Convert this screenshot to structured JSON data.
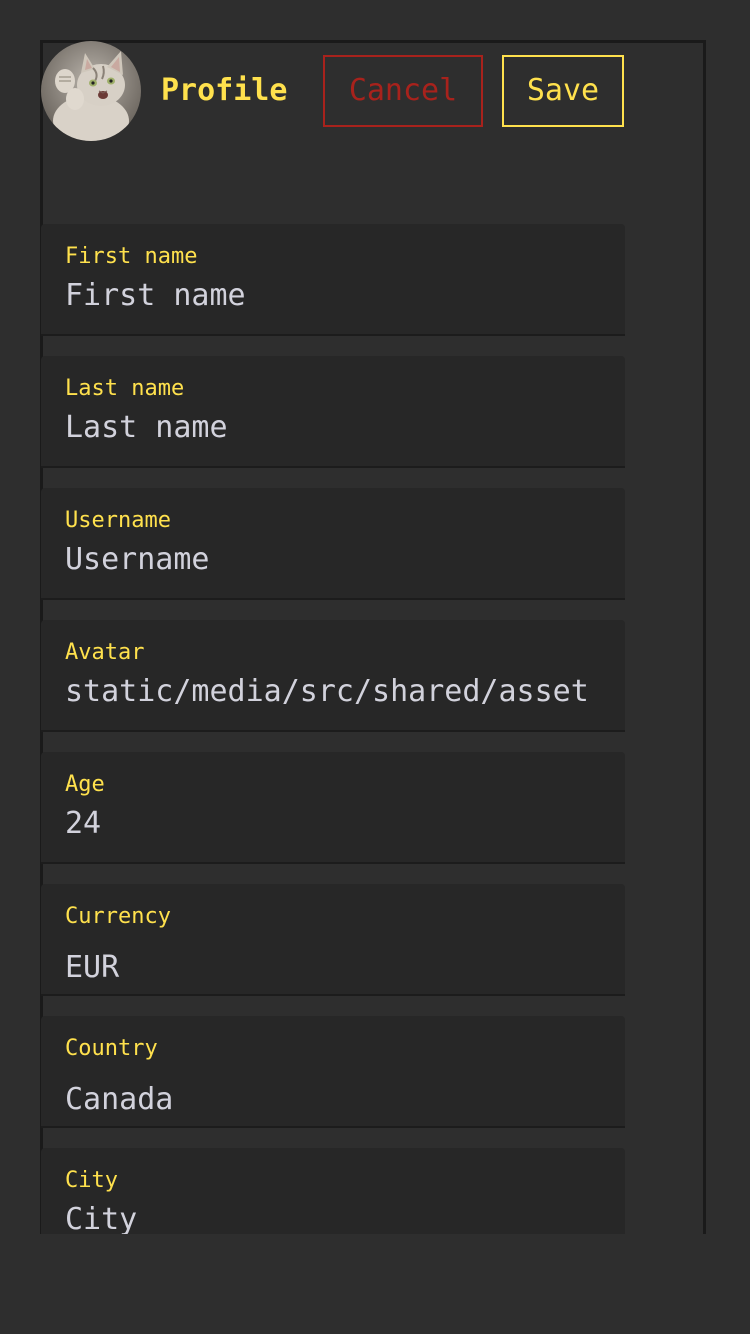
{
  "colors": {
    "accent": "#ffe14d",
    "cancel": "#a8221c",
    "text": "#d2d2dc",
    "background": "#2e2e2e",
    "field_background": "#272727"
  },
  "header": {
    "avatar_icon": "cat-avatar-icon",
    "title": "Profile",
    "cancel_label": "Cancel",
    "save_label": "Save"
  },
  "fields": [
    {
      "label": "First name",
      "value": "First name"
    },
    {
      "label": "Last name",
      "value": "Last name"
    },
    {
      "label": "Username",
      "value": "Username"
    },
    {
      "label": "Avatar",
      "value": "static/media/src/shared/asset"
    },
    {
      "label": "Age",
      "value": "24"
    },
    {
      "label": "Currency",
      "value": "EUR"
    },
    {
      "label": "Country",
      "value": "Canada"
    },
    {
      "label": "City",
      "value": "City"
    }
  ]
}
